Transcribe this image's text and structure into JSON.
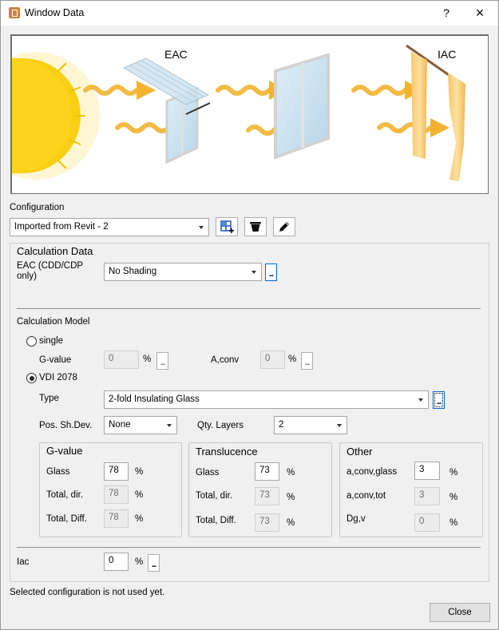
{
  "window": {
    "title": "Window Data",
    "help": "?",
    "close": "×"
  },
  "illustration": {
    "eac_label": "EAC",
    "iac_label": "IAC"
  },
  "configuration": {
    "label": "Configuration",
    "selected": "Imported from Revit - 2"
  },
  "calc_data": {
    "title": "Calculation Data",
    "eac_label": "EAC (CDD/CDP\nonly)",
    "eac_value": "No Shading",
    "dots": "..."
  },
  "calc_model": {
    "title": "Calculation Model",
    "single_label": "single",
    "single_checked": false,
    "gvalue_label": "G-value",
    "gvalue": "0",
    "aconv_label": "A,conv",
    "aconv": "0",
    "pct": "%",
    "vdi_label": "VDI 2078",
    "vdi_checked": true,
    "type_label": "Type",
    "type_value": "2-fold Insulating Glass",
    "possh_label": "Pos. Sh.Dev.",
    "possh_value": "None",
    "qty_label": "Qty. Layers",
    "qty_value": "2"
  },
  "gvalue_group": {
    "title": "G-value",
    "rows": [
      {
        "label": "Glass",
        "value": "78",
        "enabled": true
      },
      {
        "label": "Total, dir.",
        "value": "78",
        "enabled": false
      },
      {
        "label": "Total, Diff.",
        "value": "78",
        "enabled": false
      }
    ]
  },
  "translucence_group": {
    "title": "Translucence",
    "rows": [
      {
        "label": "Glass",
        "value": "73",
        "enabled": true
      },
      {
        "label": "Total, dir.",
        "value": "73",
        "enabled": false
      },
      {
        "label": "Total, Diff.",
        "value": "73",
        "enabled": false
      }
    ]
  },
  "other_group": {
    "title": "Other",
    "rows": [
      {
        "label": "a,conv,glass",
        "value": "3",
        "enabled": true
      },
      {
        "label": "a,conv,tot",
        "value": "3",
        "enabled": false
      },
      {
        "label": "Dg,v",
        "value": "0",
        "enabled": false
      }
    ]
  },
  "iac": {
    "label": "Iac",
    "value": "0"
  },
  "status": "Selected configuration is not used yet.",
  "footer": {
    "close_label": "Close"
  }
}
